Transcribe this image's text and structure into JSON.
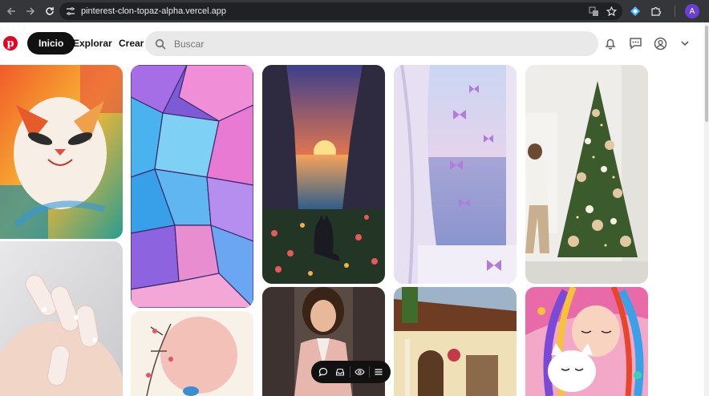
{
  "browser": {
    "url": "pinterest-clon-topaz-alpha.vercel.app",
    "profile_initial": "A"
  },
  "header": {
    "home_label": "Inicio",
    "explore_label": "Explorar",
    "create_label": "Crear",
    "search_placeholder": "Buscar"
  },
  "colors": {
    "brand": "#e60023",
    "chrome_bg": "#35363a",
    "search_bg": "#e9e9e9"
  },
  "icons": [
    "back-icon",
    "forward-icon",
    "reload-icon",
    "site-settings-icon",
    "translate-icon",
    "bookmark-star-icon",
    "extension-icon",
    "puzzle-icon",
    "more-icon",
    "pinterest-logo",
    "search-icon",
    "bell-icon",
    "messages-icon",
    "account-icon",
    "chevron-down-icon",
    "comment-icon",
    "inbox-icon",
    "eye-icon",
    "menu-icon"
  ],
  "pins": [
    {
      "name": "pin-colorful-cat"
    },
    {
      "name": "pin-manicure-nails"
    },
    {
      "name": "pin-stained-glass-flowers"
    },
    {
      "name": "pin-pink-watercolor"
    },
    {
      "name": "pin-sunset-cat"
    },
    {
      "name": "pin-woman-pink-suit"
    },
    {
      "name": "pin-window-butterflies"
    },
    {
      "name": "pin-house-porch"
    },
    {
      "name": "pin-christmas-tree"
    },
    {
      "name": "pin-girl-with-cat"
    }
  ]
}
